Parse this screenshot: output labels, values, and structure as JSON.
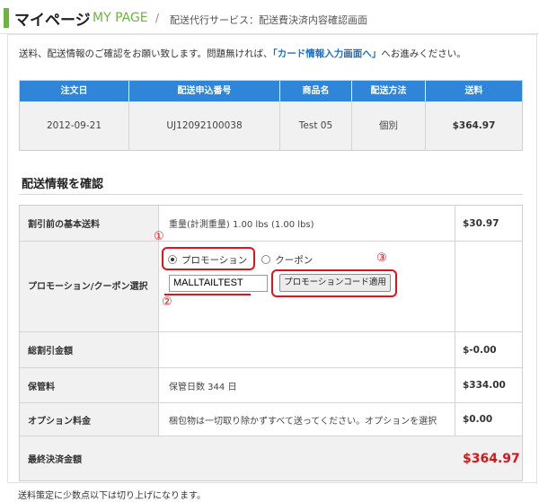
{
  "header": {
    "title": "マイページ",
    "title_en": "MY PAGE",
    "separator": "/",
    "breadcrumb": "配送代行サービス：配送費決済内容確認画面"
  },
  "intro": {
    "before": "送料、配送情報のご確認をお願い致します。問題無ければ、",
    "link": "「カード情報入力画面へ」",
    "after": "へお進みください。"
  },
  "order_table": {
    "headers": [
      "注文日",
      "配送申込番号",
      "商品名",
      "配送方法",
      "送料"
    ],
    "row": [
      "2012-09-21",
      "UJ12092100038",
      "Test 05",
      "個別",
      "$364.97"
    ]
  },
  "section": {
    "title": "配送情報を確認"
  },
  "shipping": {
    "base": {
      "label": "割引前の基本送料",
      "detail": "重量(計測重量) 1.00 lbs (1.00 lbs)",
      "value": "$30.97"
    },
    "promo": {
      "label": "プロモーション/クーポン選択",
      "option_promo": "プロモーション",
      "option_coupon": "クーポン",
      "code": "MALLTAILTEST",
      "apply_label": "プロモーションコード適用"
    },
    "discount": {
      "label": "総割引金額",
      "detail": "",
      "value": "$-0.00"
    },
    "storage": {
      "label": "保管料",
      "detail": "保管日数 344 日",
      "value": "$334.00"
    },
    "option": {
      "label": "オプション料金",
      "detail": "梱包物は一切取り除かずすべて送ってください。オプションを選択",
      "value": "$0.00"
    },
    "total": {
      "label": "最終決済金額",
      "value": "$364.97"
    }
  },
  "annotations": {
    "n1": "①",
    "n2": "②",
    "n3": "③"
  },
  "footnote": "送料策定に少数点以下は切り上げになります。",
  "colors": {
    "accent_green": "#6cb33f",
    "header_blue": "#2f86d8",
    "link_blue": "#1a6fc9",
    "total_red": "#d7141a",
    "annotation_red": "#e3131b"
  }
}
